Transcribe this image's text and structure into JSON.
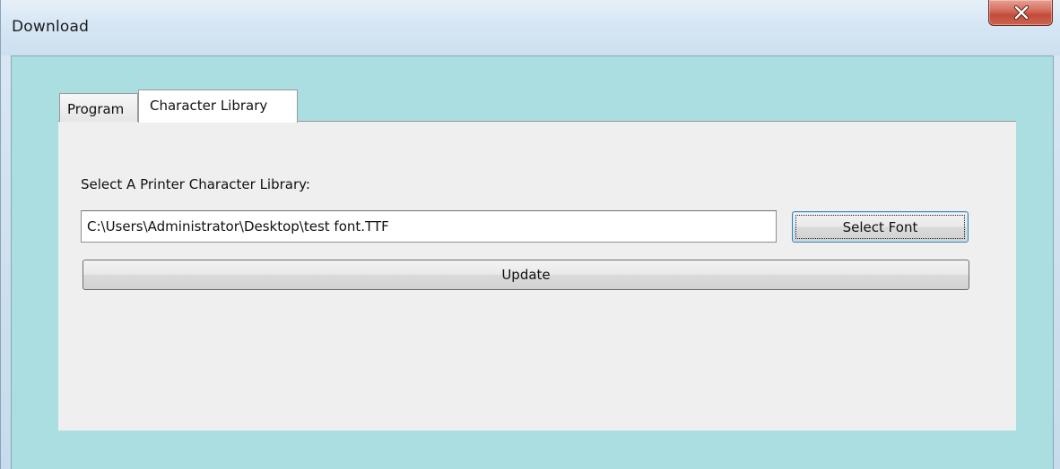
{
  "window": {
    "title": "Download",
    "close_icon": "close-x-icon"
  },
  "tabs": [
    {
      "label": "Program",
      "selected": false
    },
    {
      "label": "Character Library",
      "selected": true
    }
  ],
  "character_library": {
    "label": "Select A Printer Character Library:",
    "path_value": "C:\\Users\\Administrator\\Desktop\\test font.TTF",
    "select_font_label": "Select Font",
    "update_label": "Update"
  }
}
